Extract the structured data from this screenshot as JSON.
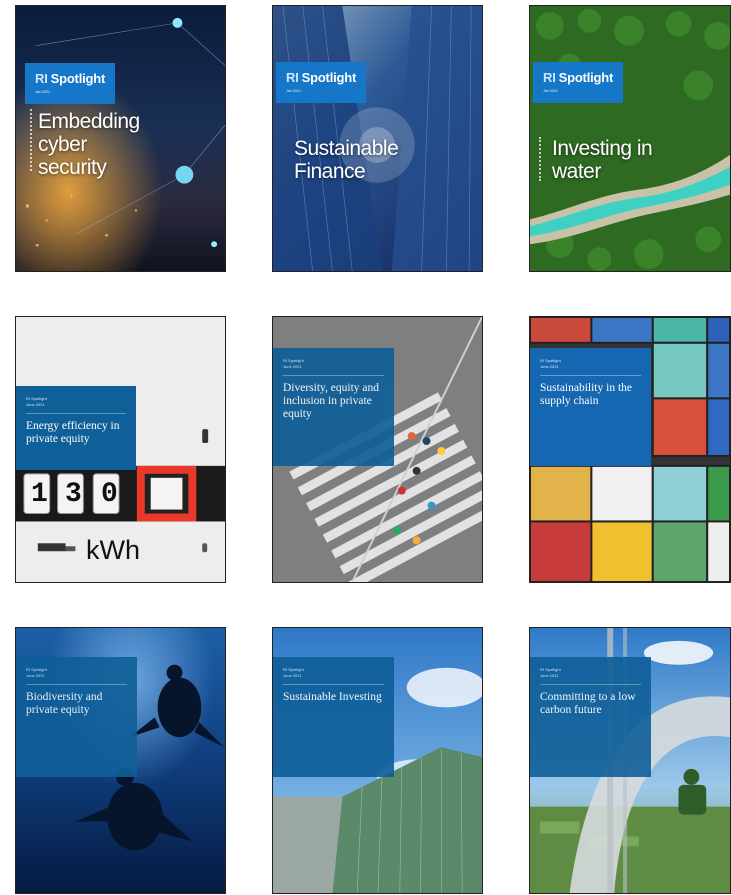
{
  "colors": {
    "brand_blue": "#1677c9",
    "box_blue": "#0f5f99"
  },
  "covers": [
    {
      "brand": "RI",
      "brand_name": "Spotlight",
      "brand_sub": "Jan 2021",
      "title_lines": [
        "Embedding",
        "cyber",
        "security"
      ]
    },
    {
      "brand": "RI",
      "brand_name": "Spotlight",
      "brand_sub": "Jan 2021",
      "title_lines": [
        "Sustainable",
        "Finance"
      ]
    },
    {
      "brand": "RI",
      "brand_name": "Spotlight",
      "brand_sub": "Jan 2021",
      "title_lines": [
        "Investing in",
        "water"
      ]
    },
    {
      "kicker": "RI Spotlight",
      "kicker2": "June 2021",
      "title": "Energy efficiency in private equity",
      "meter_digits": [
        "1",
        "3",
        "0"
      ],
      "meter_unit": "kWh"
    },
    {
      "kicker": "RI Spotlight",
      "kicker2": "June 2021",
      "title": "Diversity, equity and inclusion in private equity"
    },
    {
      "kicker": "RI Spotlight",
      "kicker2": "June 2021",
      "title": "Sustainability in the supply chain"
    },
    {
      "kicker": "RI Spotlight",
      "kicker2": "June 2021",
      "title": "Biodiversity and private equity"
    },
    {
      "kicker": "RI Spotlight",
      "kicker2": "June 2021",
      "title": "Sustainable Investing"
    },
    {
      "kicker": "RI Spotlight",
      "kicker2": "June 2021",
      "title": "Committing to a low carbon future"
    }
  ]
}
